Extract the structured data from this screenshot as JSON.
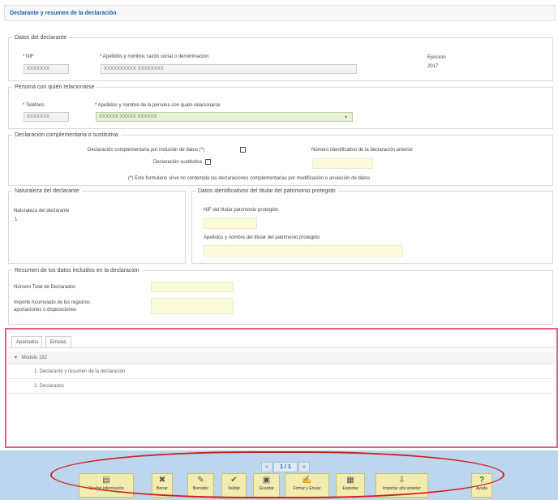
{
  "header": {
    "title": "Declarante y resumen de la declaración"
  },
  "declarante": {
    "legend": "Datos del declarante",
    "nif_label": "* NIF",
    "nif_value": "XXXXXXX",
    "nombre_label": "* Apellidos y nombre, razón social o denominación",
    "nombre_value": "XXXXXXXXXX XXXXXXXX",
    "ejercicio_label": "Ejercicio",
    "ejercicio_value": "2017"
  },
  "relacion": {
    "legend": "Persona con quién relacionarse",
    "telefono_label": "* Teléfono",
    "telefono_value": "XXXXXXX",
    "persona_label": "* Apellidos y nombre de la persona con quién relacionarse",
    "persona_value": "XXXXXX XXXXX XXXXXX"
  },
  "complementaria": {
    "legend": "Declaración complementaria o sustitutiva",
    "complementaria_label": "Declaración complementaria por inclusión de datos (*)",
    "sustitutiva_label": "Declaración sustitutiva",
    "numero_label": "Número identificativo de la declaración anterior",
    "nota": "(*) Este formulario sirve no contempla las declaraciones complementarias por modificación o anulación de datos"
  },
  "naturaleza": {
    "legend": "Naturaleza del declarante",
    "label": "Naturaleza del declarante",
    "value": "1"
  },
  "titular": {
    "legend": "Datos identificativos del titular del patrimonio protegido",
    "nif_label": "NIF del titular patrimonio protegido",
    "nombre_label": "Apellidos y nombre del titular del patrimonio protegido"
  },
  "resumen": {
    "legend": "Resumen de los datos incluidos en la declaración",
    "total_label": "Número Total de Declarados",
    "importe_label": "Importe Acumulado de los registros",
    "importe_label2": "aportaciones o disposiciones"
  },
  "tabs": [
    {
      "label": "Apartados"
    },
    {
      "label": "Errores"
    }
  ],
  "tree": {
    "root": "Modelo 182",
    "items": [
      {
        "label": "1. Declarante y resumen de la declaración"
      },
      {
        "label": "2. Declarados"
      }
    ]
  },
  "pager": {
    "prev": "«",
    "current": "1 / 1",
    "next": "»"
  },
  "toolbar": [
    {
      "label": "Ocultar Información",
      "icon": "▤"
    },
    {
      "label": "Borrar",
      "icon": "✖"
    },
    {
      "label": "Borrador",
      "icon": "✎"
    },
    {
      "label": "Validar",
      "icon": "✔"
    },
    {
      "label": "Guardar",
      "icon": "▣"
    },
    {
      "label": "Firmar y Enviar",
      "icon": "✍"
    },
    {
      "label": "Exportar",
      "icon": "▦"
    },
    {
      "label": "Importar año anterior",
      "icon": "⇩"
    },
    {
      "label": "Ayuda",
      "icon": "?"
    }
  ],
  "colors": {
    "accent": "#1c5fa8",
    "highlight_red": "#d51c1c",
    "toolbar_bg": "#bcd6ee",
    "button_bg": "#f2ecae"
  }
}
